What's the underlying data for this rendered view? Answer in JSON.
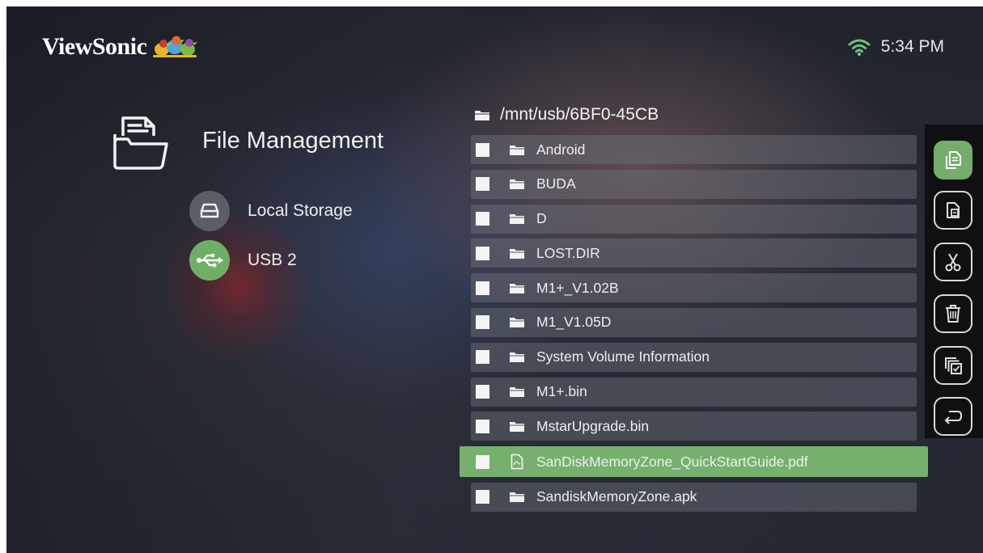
{
  "header": {
    "brand": "ViewSonic",
    "time": "5:34 PM",
    "wifi_icon": "wifi-icon"
  },
  "page": {
    "title": "File Management",
    "icon": "folder-document-icon"
  },
  "storage": [
    {
      "label": "Local Storage",
      "icon": "drive-icon",
      "selected": false
    },
    {
      "label": "USB 2",
      "icon": "usb-icon",
      "selected": true
    }
  ],
  "browser": {
    "path": "/mnt/usb/6BF0-45CB",
    "items": [
      {
        "name": "Android",
        "type": "folder"
      },
      {
        "name": "BUDA",
        "type": "folder"
      },
      {
        "name": "D",
        "type": "folder"
      },
      {
        "name": "LOST.DIR",
        "type": "folder"
      },
      {
        "name": "M1+_V1.02B",
        "type": "folder"
      },
      {
        "name": "M1_V1.05D",
        "type": "folder"
      },
      {
        "name": "System Volume Information",
        "type": "folder"
      },
      {
        "name": "M1+.bin",
        "type": "folder"
      },
      {
        "name": "MstarUpgrade.bin",
        "type": "folder"
      },
      {
        "name": "SanDiskMemoryZone_QuickStartGuide.pdf",
        "type": "pdf",
        "selected": true
      },
      {
        "name": "SandiskMemoryZone.apk",
        "type": "folder"
      }
    ]
  },
  "actions": [
    {
      "icon": "copy-icon",
      "active": true
    },
    {
      "icon": "paste-icon",
      "active": false
    },
    {
      "icon": "cut-icon",
      "active": false
    },
    {
      "icon": "delete-icon",
      "active": false
    },
    {
      "icon": "select-all-icon",
      "active": false
    },
    {
      "icon": "back-icon",
      "active": false
    }
  ],
  "colors": {
    "accent_green": "#77b06e",
    "row_bg": "#5d6068",
    "sidebar_bg": "#0e0e10"
  }
}
